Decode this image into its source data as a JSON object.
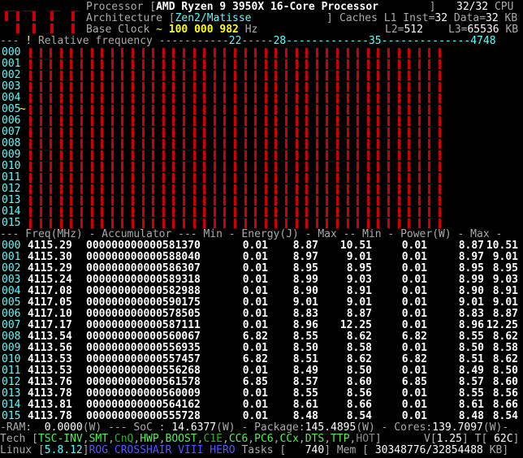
{
  "header": {
    "processor_label": "Processor [",
    "processor": "AMD Ryzen 9 3950X 16-Core Processor",
    "processor_close": "]",
    "threads": "32/32",
    "threads_unit": "CPU",
    "arch_label": "Architecture [",
    "arch": "Zen2/Matisse",
    "arch_close": "]",
    "caches_label": "Caches L1 Inst=",
    "l1i": "32",
    "l1d_label": "Data=",
    "l1d": "32",
    "kb": "KB",
    "clock_label": "Base Clock",
    "clock_tilde": "~",
    "clock": "100 000 982",
    "hz": "Hz",
    "l2_label": "L2=",
    "l2": "512",
    "l3_label": "L3=",
    "l3": "65536",
    "kb2": "KB"
  },
  "freqbar": {
    "dashes": "---",
    "bang": "!",
    "label": "Relative frequency",
    "m22": "22",
    "m28": "28",
    "m35": "35",
    "m47": "47",
    "m48": "48"
  },
  "cores": [
    "000",
    "001",
    "002",
    "003",
    "004",
    "005",
    "006",
    "007",
    "008",
    "009",
    "010",
    "011",
    "012",
    "013",
    "014",
    "015"
  ],
  "table": {
    "header": "--- Freq(MHz) - Accumulator --- Min - Energy(J) - Max -- Min - Power(W) - Max -",
    "rows": [
      {
        "id": "000",
        "freq": "4115.29",
        "acc": "000000000000581370",
        "emin": "0.01",
        "e": "8.87",
        "emax": "10.51",
        "pmin": "0.01",
        "p": "8.87",
        "pmax": "10.51"
      },
      {
        "id": "001",
        "freq": "4115.30",
        "acc": "000000000000588040",
        "emin": "0.01",
        "e": "8.97",
        "emax": "9.01",
        "pmin": "0.01",
        "p": "8.97",
        "pmax": "9.01"
      },
      {
        "id": "002",
        "freq": "4115.29",
        "acc": "000000000000586307",
        "emin": "0.01",
        "e": "8.95",
        "emax": "8.95",
        "pmin": "0.01",
        "p": "8.95",
        "pmax": "8.95"
      },
      {
        "id": "003",
        "freq": "4115.24",
        "acc": "000000000000589318",
        "emin": "0.01",
        "e": "8.99",
        "emax": "9.03",
        "pmin": "0.01",
        "p": "8.99",
        "pmax": "9.03"
      },
      {
        "id": "004",
        "freq": "4117.08",
        "acc": "000000000000582988",
        "emin": "0.01",
        "e": "8.90",
        "emax": "8.91",
        "pmin": "0.01",
        "p": "8.90",
        "pmax": "8.91"
      },
      {
        "id": "005",
        "freq": "4117.05",
        "acc": "000000000000590175",
        "emin": "0.01",
        "e": "9.01",
        "emax": "9.01",
        "pmin": "0.01",
        "p": "9.01",
        "pmax": "9.01"
      },
      {
        "id": "006",
        "freq": "4117.10",
        "acc": "000000000000578505",
        "emin": "0.01",
        "e": "8.83",
        "emax": "8.87",
        "pmin": "0.01",
        "p": "8.83",
        "pmax": "8.87"
      },
      {
        "id": "007",
        "freq": "4117.17",
        "acc": "000000000000587111",
        "emin": "0.01",
        "e": "8.96",
        "emax": "12.25",
        "pmin": "0.01",
        "p": "8.96",
        "pmax": "12.25"
      },
      {
        "id": "008",
        "freq": "4113.54",
        "acc": "000000000000560067",
        "emin": "6.82",
        "e": "8.55",
        "emax": "8.62",
        "pmin": "6.82",
        "p": "8.55",
        "pmax": "8.62"
      },
      {
        "id": "009",
        "freq": "4113.56",
        "acc": "000000000000556935",
        "emin": "0.01",
        "e": "8.50",
        "emax": "8.58",
        "pmin": "0.01",
        "p": "8.50",
        "pmax": "8.58"
      },
      {
        "id": "010",
        "freq": "4113.53",
        "acc": "000000000000557457",
        "emin": "6.82",
        "e": "8.51",
        "emax": "8.62",
        "pmin": "6.82",
        "p": "8.51",
        "pmax": "8.62"
      },
      {
        "id": "011",
        "freq": "4113.53",
        "acc": "000000000000556268",
        "emin": "0.01",
        "e": "8.49",
        "emax": "8.50",
        "pmin": "0.01",
        "p": "8.49",
        "pmax": "8.50"
      },
      {
        "id": "012",
        "freq": "4113.76",
        "acc": "000000000000561578",
        "emin": "6.85",
        "e": "8.57",
        "emax": "8.60",
        "pmin": "6.85",
        "p": "8.57",
        "pmax": "8.60"
      },
      {
        "id": "013",
        "freq": "4113.78",
        "acc": "000000000000560009",
        "emin": "0.01",
        "e": "8.55",
        "emax": "8.56",
        "pmin": "0.01",
        "p": "8.55",
        "pmax": "8.56"
      },
      {
        "id": "014",
        "freq": "4113.81",
        "acc": "000000000000564162",
        "emin": "0.01",
        "e": "8.61",
        "emax": "8.66",
        "pmin": "0.01",
        "p": "8.61",
        "pmax": "8.66"
      },
      {
        "id": "015",
        "freq": "4113.78",
        "acc": "000000000000555728",
        "emin": "0.01",
        "e": "8.48",
        "emax": "8.54",
        "pmin": "0.01",
        "p": "8.48",
        "pmax": "8.54"
      }
    ]
  },
  "power": {
    "ram_label": "-RAM:",
    "ram": "0.0000",
    "w1": "(W) --- SoC :",
    "soc": "14.6377",
    "w2": "(W) - Package:",
    "pkg": "145.4895",
    "w3": "(W) - Cores:",
    "cores": "139.7097",
    "w4": "(W)-"
  },
  "tech": {
    "label": "Tech [",
    "items": [
      "TSC-INV",
      "SMT",
      "CnQ",
      "HWP",
      "BOOST",
      "C1E",
      "CC6",
      "PC6",
      "CCx",
      "DTS",
      "TTP",
      "HOT"
    ],
    "close": "]",
    "v_label": "V[",
    "v": "1.25",
    "v_close": "]",
    "t_label": "T[",
    "t": "62C",
    "t_close": "]"
  },
  "status": {
    "os": "Linux",
    "kernel": "5.8.12",
    "board": "ROG CROSSHAIR VIII HERO",
    "tasks_label": "Tasks [",
    "tasks": "740",
    "tasks_close": "]",
    "mem_label": "Mem [",
    "mem": "30348776/32854488",
    "mem_unit": "KB]"
  },
  "colors": {
    "bar": "#c00000",
    "accent": "#55ffff",
    "highlight": "#ffff00"
  }
}
